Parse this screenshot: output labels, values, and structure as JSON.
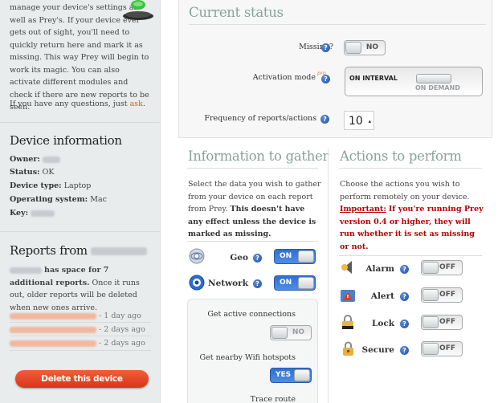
{
  "sidebar": {
    "intro_text": "manage your device's settings as well as Prey's. If your device ever gets out of sight, you'll need to quickly return here and mark it as missing. This way Prey will begin to work its magic. You can also activate different modules and check if there are new reports to be seen.",
    "questions_text": "If you have any questions, just",
    "ask_link": "ask",
    "device_info_heading": "Device information",
    "device_info": {
      "owner_label": "Owner:",
      "status_label": "Status:",
      "status_value": "OK",
      "device_type_label": "Device type:",
      "device_type_value": "Laptop",
      "os_label": "Operating system:",
      "os_value": "Mac",
      "key_label": "Key:"
    },
    "reports_heading": "Reports from",
    "space_text_bold": "has space for 7 additional reports.",
    "space_text_rest": "Once it runs out, older reports will be deleted when new ones arrive.",
    "reports": [
      {
        "age": "- 1 day ago"
      },
      {
        "age": "- 2 days ago"
      },
      {
        "age": "- 2 days ago"
      }
    ],
    "delete_button": "Delete this device"
  },
  "current_status": {
    "title": "Current status",
    "missing_label": "Missing?",
    "missing_value": "NO",
    "activation_mode_label": "Activation mode",
    "pro_badge": "pro",
    "activation_on_interval": "ON INTERVAL",
    "activation_on_demand": "ON DEMAND",
    "frequency_label": "Frequency of reports/actions",
    "frequency_value": "10"
  },
  "info_gather": {
    "title": "Information to gather",
    "desc_plain": "Select the data you wish to gather from your device on each report from Prey.",
    "desc_bold": "This doesn't have any effect unless the device is marked as missing.",
    "items": [
      {
        "label": "Geo",
        "value": "ON",
        "icon": "geo-icon"
      },
      {
        "label": "Network",
        "value": "ON",
        "icon": "network-icon"
      }
    ],
    "network_options": [
      {
        "label": "Get active connections",
        "value": "NO"
      },
      {
        "label": "Get nearby Wifi hotspots",
        "value": "YES"
      },
      {
        "label": "Trace route",
        "value": ""
      }
    ]
  },
  "actions": {
    "title": "Actions to perform",
    "desc_plain": "Choose the actions you wish to perform remotely on your device.",
    "desc_important": "Important:",
    "desc_warning": "If you're running Prey version 0.4 or higher, they will run whether it is set as missing or not.",
    "items": [
      {
        "label": "Alarm",
        "value": "OFF",
        "icon": "alarm-icon"
      },
      {
        "label": "Alert",
        "value": "OFF",
        "icon": "alert-icon"
      },
      {
        "label": "Lock",
        "value": "OFF",
        "icon": "lock-icon"
      },
      {
        "label": "Secure",
        "value": "OFF",
        "icon": "secure-icon"
      }
    ]
  },
  "help_glyph": "?",
  "colors": {
    "sidebar_bg": "#e9ecec",
    "section_title": "#8aa29b",
    "toggle_on": "#3a7bdc",
    "delete_button": "#e5462a",
    "warning_text": "#b60000",
    "link": "#e05a20"
  }
}
